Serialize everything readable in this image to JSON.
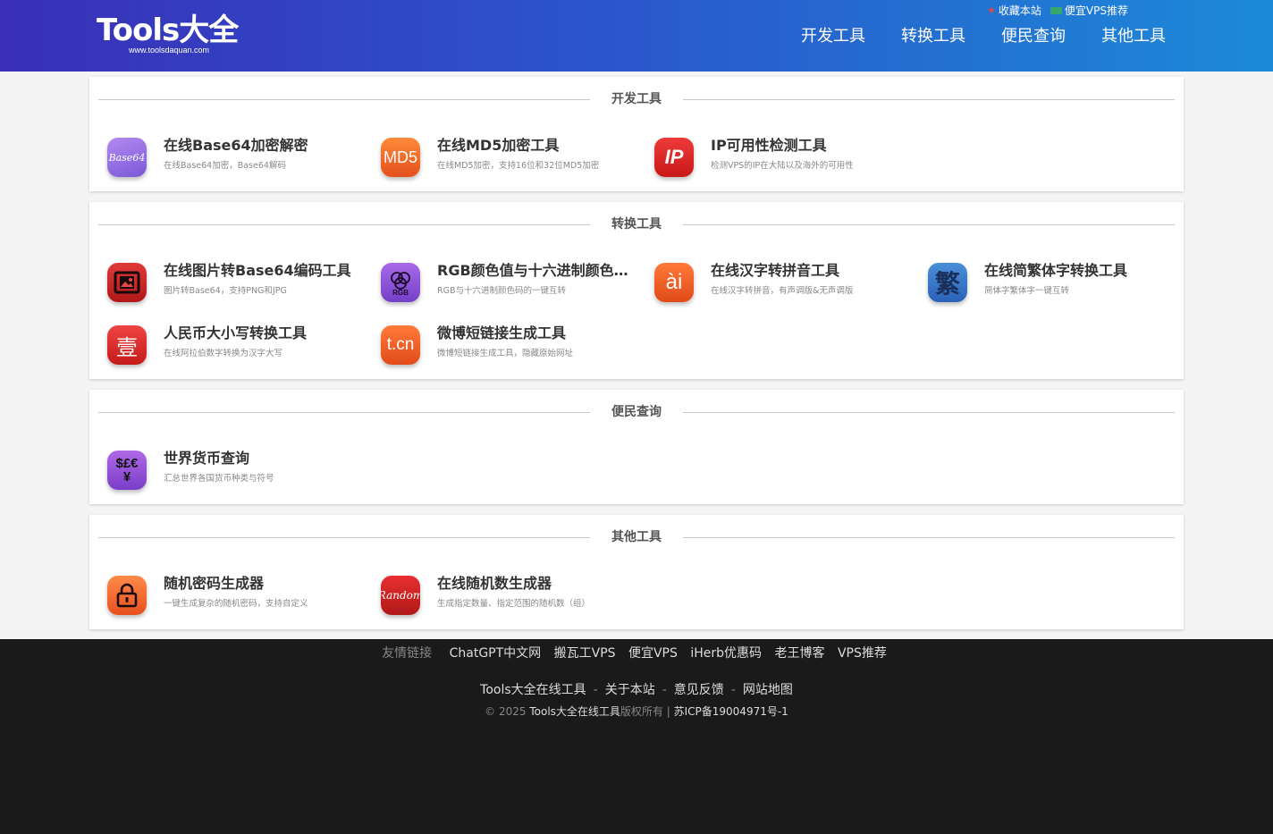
{
  "header": {
    "logo_text": "Tools大全",
    "logo_sub": "www.toolsdaquan.com",
    "top_links": [
      "收藏本站",
      "便宜VPS推荐"
    ],
    "nav": [
      "开发工具",
      "转换工具",
      "便民查询",
      "其他工具"
    ]
  },
  "sections": {
    "dev": {
      "title": "开发工具",
      "tools": [
        {
          "name": "在线Base64加密解密",
          "desc": "在线Base64加密，Base64解码",
          "icon": "Base64"
        },
        {
          "name": "在线MD5加密工具",
          "desc": "在线MD5加密，支持16位和32位MD5加密",
          "icon": "MD5"
        },
        {
          "name": "IP可用性检测工具",
          "desc": "检测VPS的IP在大陆以及海外的可用性",
          "icon": "IP"
        }
      ]
    },
    "convert": {
      "title": "转换工具",
      "tools": [
        {
          "name": "在线图片转Base64编码工具",
          "desc": "图片转Base64，支持PNG和JPG",
          "icon": "image-icon"
        },
        {
          "name": "RGB颜色值与十六进制颜色码转换工具",
          "desc": "RGB与十六进制颜色码的一键互转",
          "icon": "RGB"
        },
        {
          "name": "在线汉字转拼音工具",
          "desc": "在线汉字转拼音，有声调版&无声调版",
          "icon": "ài"
        },
        {
          "name": "在线简繁体字转换工具",
          "desc": "简体字繁体字一键互转",
          "icon": "繁"
        },
        {
          "name": "人民币大小写转换工具",
          "desc": "在线阿拉伯数字转换为汉字大写",
          "icon": "壹"
        },
        {
          "name": "微博短链接生成工具",
          "desc": "微博短链接生成工具，隐藏原始网址",
          "icon": "t.cn"
        }
      ]
    },
    "query": {
      "title": "便民查询",
      "tools": [
        {
          "name": "世界货币查询",
          "desc": "汇总世界各国货币种类与符号",
          "icon": "$£€¥"
        }
      ]
    },
    "other": {
      "title": "其他工具",
      "tools": [
        {
          "name": "随机密码生成器",
          "desc": "一键生成复杂的随机密码，支持自定义",
          "icon": "lock-icon"
        },
        {
          "name": "在线随机数生成器",
          "desc": "生成指定数量、指定范围的随机数（组）",
          "icon": "Random"
        }
      ]
    }
  },
  "footer": {
    "friends_label": "友情链接",
    "friends": [
      "ChatGPT中文网",
      "搬瓦工VPS",
      "便宜VPS",
      "iHerb优惠码",
      "老王博客",
      "VPS推荐"
    ],
    "links": [
      "Tools大全在线工具",
      "关于本站",
      "意见反馈",
      "网站地图"
    ],
    "copyright_prefix": "© 2025",
    "copyright_site": "Tools大全在线工具",
    "copyright_mid": "版权所有 |",
    "icp": "苏ICP备19004971号-1"
  }
}
